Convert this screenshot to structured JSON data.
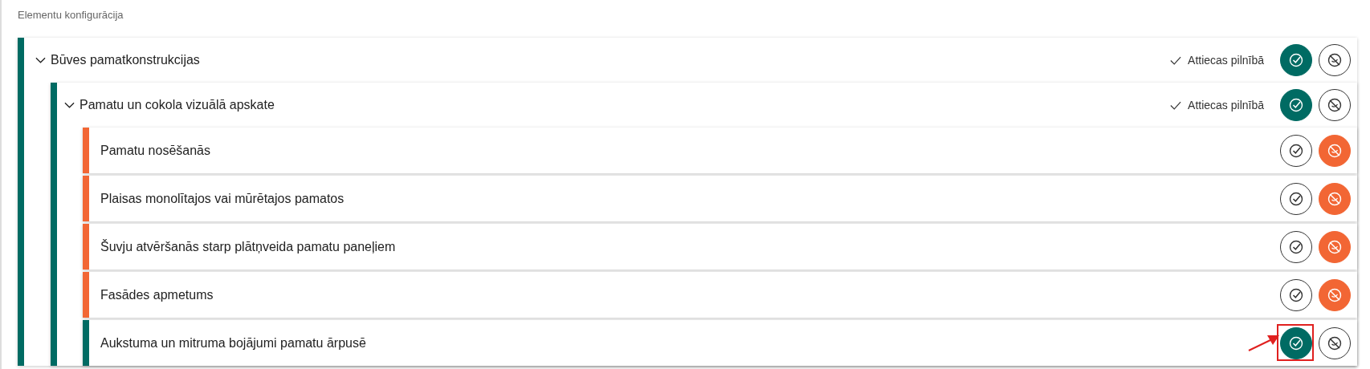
{
  "section_title": "Elementu konfigurācija",
  "tree": [
    {
      "label": "Būves pamatkonstrukcijas",
      "expanded": true,
      "applies": true,
      "status_text": "Attiecas pilnībā",
      "children": [
        {
          "label": "Pamatu un cokola vizuālā apskate",
          "expanded": true,
          "applies": true,
          "status_text": "Attiecas pilnībā",
          "children": [
            {
              "label": "Pamatu nosēšanās",
              "applies": false,
              "highlighted": false
            },
            {
              "label": "Plaisas monolītajos vai mūrētajos pamatos",
              "applies": false,
              "highlighted": false
            },
            {
              "label": "Šuvju atvēršanās starp plātņveida pamatu paneļiem",
              "applies": false,
              "highlighted": false
            },
            {
              "label": "Fasādes apmetums",
              "applies": false,
              "highlighted": false
            },
            {
              "label": "Aukstuma un mitruma bojājumi pamatu ārpusē",
              "applies": true,
              "highlighted": true
            }
          ]
        }
      ]
    }
  ]
}
